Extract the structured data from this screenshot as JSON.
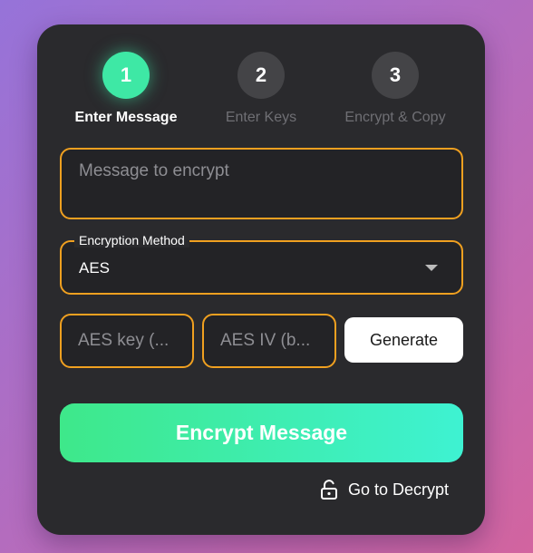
{
  "steps": [
    {
      "number": "1",
      "label": "Enter Message",
      "active": true
    },
    {
      "number": "2",
      "label": "Enter Keys",
      "active": false
    },
    {
      "number": "3",
      "label": "Encrypt & Copy",
      "active": false
    }
  ],
  "form": {
    "message_placeholder": "Message to encrypt",
    "method_label": "Encryption Method",
    "method_value": "AES",
    "key_placeholder": "AES key (...",
    "iv_placeholder": "AES IV (b...",
    "generate_label": "Generate",
    "encrypt_label": "Encrypt Message"
  },
  "footer": {
    "decrypt_label": "Go to Decrypt",
    "decrypt_icon": "lock-open-icon"
  },
  "colors": {
    "active_step": "#3ee8a5",
    "field_border": "#f0a020",
    "card_bg": "#2a2a2d",
    "encrypt_gradient_start": "#3ee88a",
    "encrypt_gradient_end": "#3ef2d2"
  }
}
